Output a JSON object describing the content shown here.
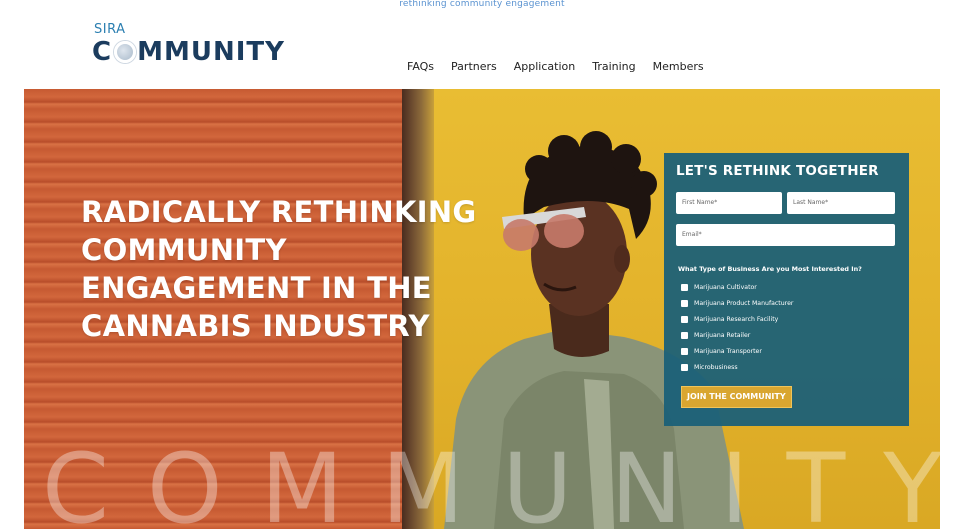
{
  "header": {
    "top_strip_text": "rethinking community engagement",
    "logo_sub": "SIRA",
    "logo_c": "C",
    "logo_rest": "MMUNITY",
    "nav": [
      "FAQs",
      "Partners",
      "Application",
      "Training",
      "Members"
    ]
  },
  "hero": {
    "title_lines": [
      "RADICALLY RETHINKING",
      "COMMUNITY",
      "ENGAGEMENT IN THE",
      "CANNABIS INDUSTRY"
    ],
    "watermark": "COMMUNITY"
  },
  "form": {
    "title": "LET'S RETHINK TOGETHER",
    "first_name_placeholder": "First Name*",
    "last_name_placeholder": "Last Name*",
    "email_placeholder": "Email*",
    "question": "What Type of Business Are you Most Interested In?",
    "options": [
      "Marijuana Cultivator",
      "Marijuana Product Manufacturer",
      "Marijuana Research Facility",
      "Marijuana Retailer",
      "Marijuana Transporter",
      "Microbusiness"
    ],
    "submit_label": "JOIN THE COMMUNITY"
  },
  "colors": {
    "brand_navy": "#1b3c5e",
    "brand_blue": "#2c7fb1",
    "panel_teal": "#1b6078",
    "button_gold": "#d9a630",
    "wall_yellow": "#e4b52b",
    "shutter_red": "#c65a32"
  }
}
